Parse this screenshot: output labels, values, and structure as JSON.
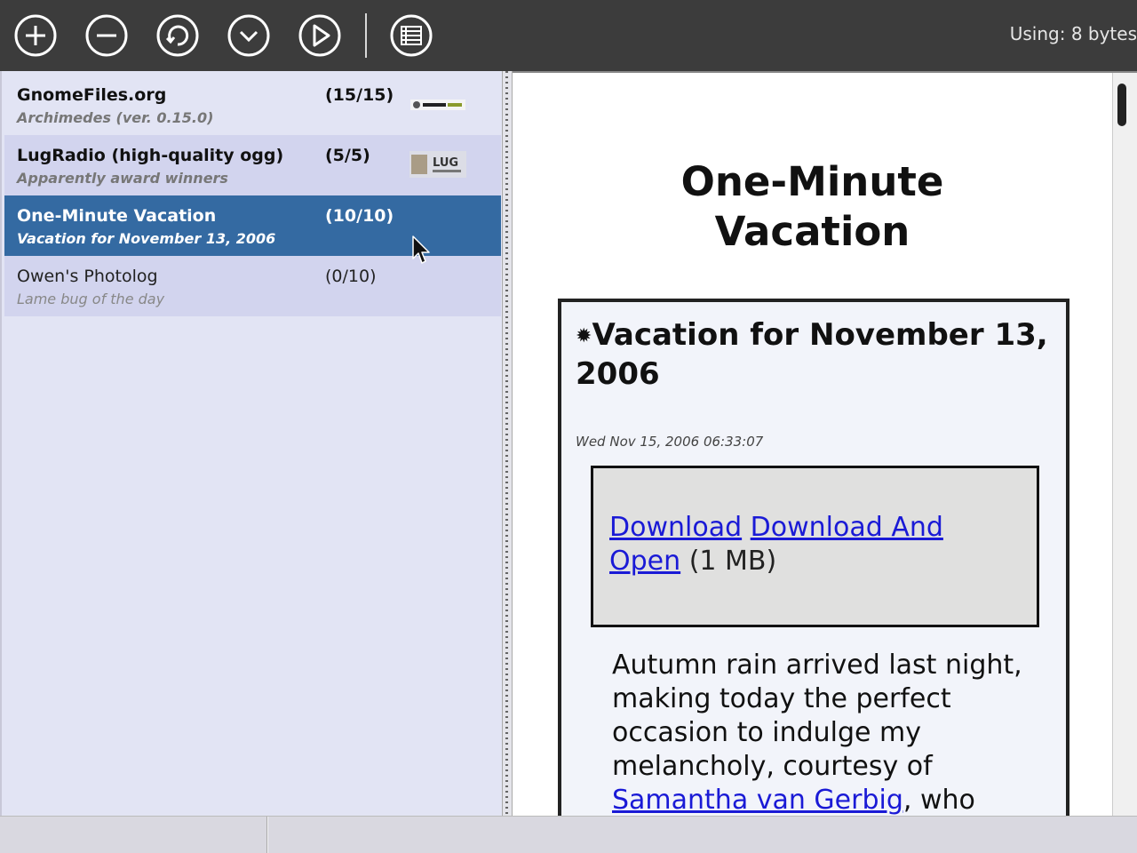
{
  "toolbar": {
    "buttons": [
      {
        "name": "add-feed-button",
        "icon": "plus-circle-icon"
      },
      {
        "name": "remove-feed-button",
        "icon": "minus-circle-icon"
      },
      {
        "name": "refresh-button",
        "icon": "refresh-circle-icon"
      },
      {
        "name": "download-button",
        "icon": "chevron-down-circle-icon"
      },
      {
        "name": "play-button",
        "icon": "play-circle-icon"
      },
      {
        "name": "view-list-button",
        "icon": "list-view-icon"
      }
    ],
    "usage": "Using: 8 bytes"
  },
  "feeds": [
    {
      "title": "GnomeFiles.org",
      "subtitle": "Archimedes (ver. 0.15.0)",
      "count": "(15/15)",
      "logo": "gnomefiles-logo"
    },
    {
      "title": "LugRadio (high-quality ogg)",
      "subtitle": "Apparently award winners",
      "count": "(5/5)",
      "logo": "lugradio-logo",
      "logo_text": "LUG"
    },
    {
      "title": "One-Minute Vacation",
      "subtitle": "Vacation for November 13, 2006",
      "count": "(10/10)"
    },
    {
      "title": "Owen's Photolog",
      "subtitle": "Lame bug of the day",
      "count": "(0/10)"
    }
  ],
  "content": {
    "page_title": "One-Minute Vacation",
    "item_heading": "Vacation for November 13, 2006",
    "item_date": "Wed Nov 15, 2006 06:33:07",
    "enclosure": {
      "download_label": "Download",
      "download_open_label": "Download And Open",
      "size": "(1 MB)"
    },
    "body_text": "Autumn rain arrived last night, making today the perfect occasion to indulge my melancholy, courtesy of",
    "body_link": "Samantha van Gerbig",
    "body_tail": ", who"
  },
  "colors": {
    "toolbar_bg": "#3c3c3c",
    "list_bg": "#e2e4f4",
    "list_alt": "#d2d4ee",
    "selected": "#346aa2",
    "link": "#1a1ad6"
  }
}
